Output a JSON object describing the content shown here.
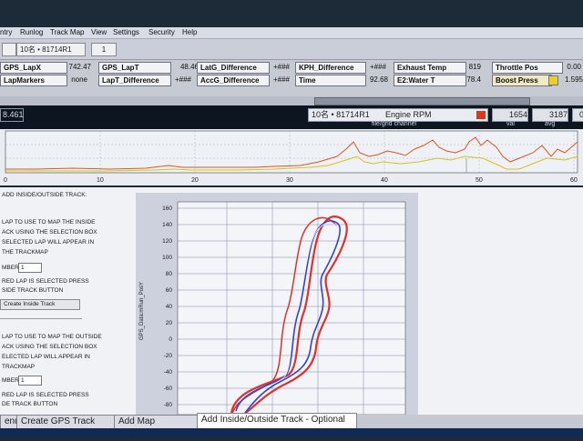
{
  "menu": [
    "ntry",
    "Runlog",
    "Track Map",
    "View",
    "Settings",
    "Security",
    "Help"
  ],
  "toolbar": {
    "car_label": "10名 • 81714R1",
    "button": "1"
  },
  "channels": {
    "row1": [
      {
        "label": "GPS_LapX",
        "value": "742.47"
      },
      {
        "label": "GPS_LapT",
        "value": "48.46"
      },
      {
        "label": "LatG_Difference",
        "value": "+###"
      },
      {
        "label": "KPH_Difference",
        "value": "+###"
      },
      {
        "label": "Exhaust Temp",
        "value": "819"
      },
      {
        "label": "Throttle Pos",
        "value": "0.00"
      }
    ],
    "row2": [
      {
        "label": "LapMarkers",
        "value": "none"
      },
      {
        "label": "LapT_Difference",
        "value": "+###"
      },
      {
        "label": "AccG_Difference",
        "value": "+###"
      },
      {
        "label": "Time",
        "value": "92.68"
      },
      {
        "label": "E2:Water T",
        "value": "78.4"
      },
      {
        "label": "Boost Press",
        "value": "1.595"
      }
    ]
  },
  "graph": {
    "left_readout": "8.461",
    "car": "10名 • 81714R1",
    "channel": "Engine RPM",
    "readout_val": "1654",
    "readout_avg": "3187",
    "readout_extra": "0",
    "subtitle": "file/grid channel",
    "col_val": "val",
    "col_avg": "avg",
    "x_ticks": [
      "0",
      "10",
      "20",
      "30",
      "40",
      "50",
      "60"
    ],
    "colors": {
      "rpm": "#e2541c",
      "throttle": "#d8c21a"
    }
  },
  "panel": {
    "title": "ADD INSIDE/OUTSIDE TRACK:",
    "inside_lines": [
      "LAP TO USE TO MAP THE INSIDE",
      "ACK USING THE SELECTION BOX",
      "SELECTED LAP WILL APPEAR IN",
      "THE TRACKMAP"
    ],
    "inside_number_label": "MBER",
    "inside_number": "1",
    "inside_hint": [
      "RED LAP IS SELECTED PRESS",
      "SIDE TRACK BUTTON"
    ],
    "inside_button": "Create Inside Track",
    "outside_lines": [
      "LAP TO USE TO MAP THE OUTSIDE",
      "ACK USING THE SELECTION BOX",
      "ELECTED LAP WILL APPEAR IN",
      "TRACKMAP"
    ],
    "outside_number_label": "MBER",
    "outside_number": "1",
    "outside_hint": [
      "RED LAP IS SELECTED PRESS",
      "DE TRACK BUTTON"
    ]
  },
  "map": {
    "ylabel": "GPS_Data:mRun_PosY",
    "y_ticks": [
      "160",
      "140",
      "120",
      "100",
      "80",
      "60",
      "40",
      "20",
      "0",
      "-20",
      "-40",
      "-60",
      "-80"
    ],
    "colors": {
      "outside": "#e0302a",
      "inside": "#2f43d8"
    }
  },
  "tabs": [
    "enu",
    "Create GPS Track Map",
    "Add Map Segments",
    "Add Inside/Outside Track - Optional"
  ]
}
